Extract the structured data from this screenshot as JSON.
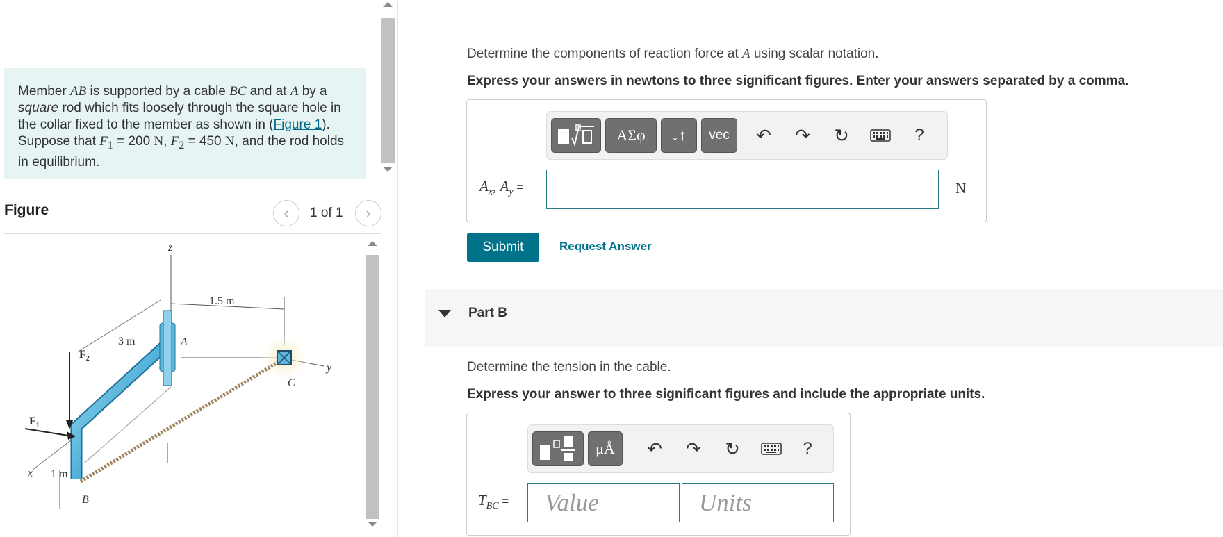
{
  "problem": {
    "t1": "Member ",
    "m1": "AB",
    "t2": " is supported by a cable ",
    "m2": "BC",
    "t3": " and at ",
    "m3": "A",
    "t4": " by a ",
    "em": "square",
    "t5": " rod which fits loosely through the square hole in the collar fixed to the member as shown in (",
    "link": "Figure 1",
    "t6": "). Suppose that ",
    "f1": "F",
    "f1_sub": "1",
    "t7": " = 200 ",
    "n1": "N",
    "t8": ", ",
    "f2": "F",
    "f2_sub": "2",
    "t9": " = 450 ",
    "n2": "N",
    "t10": ", and the rod holds in equilibrium."
  },
  "figure": {
    "label": "Figure",
    "counter": "1 of 1",
    "prev_icon": "chevron-left-icon",
    "next_icon": "chevron-right-icon",
    "labels": {
      "z": "z",
      "dim_15": "1.5 m",
      "dim_3": "3 m",
      "a": "A",
      "f2": "F",
      "f2_sub": "2",
      "c": "C",
      "y": "y",
      "f1": "F",
      "f1_sub": "1",
      "x": "x",
      "dim_1": "1 m",
      "b": "B"
    }
  },
  "part_a": {
    "prompt_pre": "Determine the components of reaction force at ",
    "prompt_var": "A",
    "prompt_post": " using scalar notation.",
    "instruction": "Express your answers in newtons to three significant figures. Enter your answers separated by a comma.",
    "toolbar": {
      "templates_icon": "templates-sqrt-icon",
      "greek": "ΑΣφ",
      "arrows": "↓↑",
      "vec": "vec",
      "undo_icon": "undo-icon",
      "redo_icon": "redo-icon",
      "reset_icon": "reset-icon",
      "keyboard_icon": "keyboard-icon",
      "help": "?"
    },
    "label_ax": "A",
    "label_ax_sub": "x",
    "label_sep": ", ",
    "label_ay": "A",
    "label_ay_sub": "y",
    "label_eq": " =",
    "unit": "N",
    "submit": "Submit",
    "request": "Request Answer"
  },
  "part_b": {
    "title": "Part B",
    "prompt": "Determine the tension in the cable.",
    "instruction": "Express your answer to three significant figures and include the appropriate units.",
    "toolbar": {
      "templates_icon": "templates-icon",
      "units": "μÅ",
      "undo_icon": "undo-icon",
      "redo_icon": "redo-icon",
      "reset_icon": "reset-icon",
      "keyboard_icon": "keyboard-icon",
      "help": "?"
    },
    "label_t": "T",
    "label_t_sub": "BC",
    "label_eq": " =",
    "value_placeholder": "Value",
    "units_placeholder": "Units"
  },
  "colors": {
    "accent": "#00738a",
    "problem_bg": "#e6f4f4",
    "button_gray": "#707070",
    "rod_blue": "#5db8dc"
  }
}
